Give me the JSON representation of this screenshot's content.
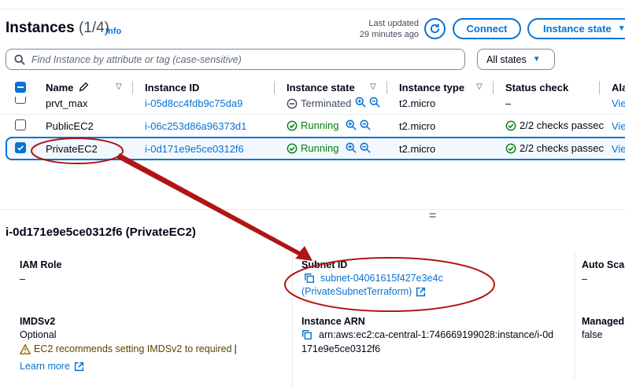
{
  "header": {
    "title": "Instances",
    "count": "(1/4)",
    "info": "Info",
    "last_updated_label": "Last updated",
    "last_updated_value": "29 minutes ago",
    "connect_label": "Connect",
    "instance_state_label": "Instance state"
  },
  "search": {
    "placeholder": "Find Instance by attribute or tag (case-sensitive)"
  },
  "filter": {
    "selected": "All states"
  },
  "table": {
    "columns": [
      "Name",
      "Instance ID",
      "Instance state",
      "Instance type",
      "Status check",
      "Ala"
    ],
    "rows": [
      {
        "name": "prvt_max",
        "instance_id": "i-05d8cc4fdb9c75da9",
        "state": "Terminated",
        "type": "t2.micro",
        "status": "–",
        "alarm": "Vie"
      },
      {
        "name": "PublicEC2",
        "instance_id": "i-06c253d86a96373d1",
        "state": "Running",
        "type": "t2.micro",
        "status": "2/2 checks passec",
        "alarm": "Vie"
      },
      {
        "name": "PrivateEC2",
        "instance_id": "i-0d171e9e5ce0312f6",
        "state": "Running",
        "type": "t2.micro",
        "status": "2/2 checks passec",
        "alarm": "Vie"
      }
    ]
  },
  "details": {
    "title": "i-0d171e9e5ce0312f6 (PrivateEC2)",
    "iam_role_label": "IAM Role",
    "iam_role_value": "–",
    "subnet_label": "Subnet ID",
    "subnet_value": "subnet-04061615f427e3e4c",
    "subnet_name": "(PrivateSubnetTerraform)",
    "auto_scal_label": "Auto Scal",
    "auto_scal_value": "–",
    "imds_label": "IMDSv2",
    "imds_value": "Optional",
    "imds_warning": "EC2 recommends setting IMDSv2 to required",
    "learn_more": "Learn more",
    "arn_label": "Instance ARN",
    "arn_line1": "arn:aws:ec2:ca-central-1:746669199028:instance/i-0d",
    "arn_line2": "171e9e5ce0312f6",
    "managed_label": "Managed",
    "managed_value": "false"
  },
  "colors": {
    "link": "#0972d3",
    "running": "#037f0c",
    "warning": "#8d6605",
    "annotation": "#b01513"
  }
}
